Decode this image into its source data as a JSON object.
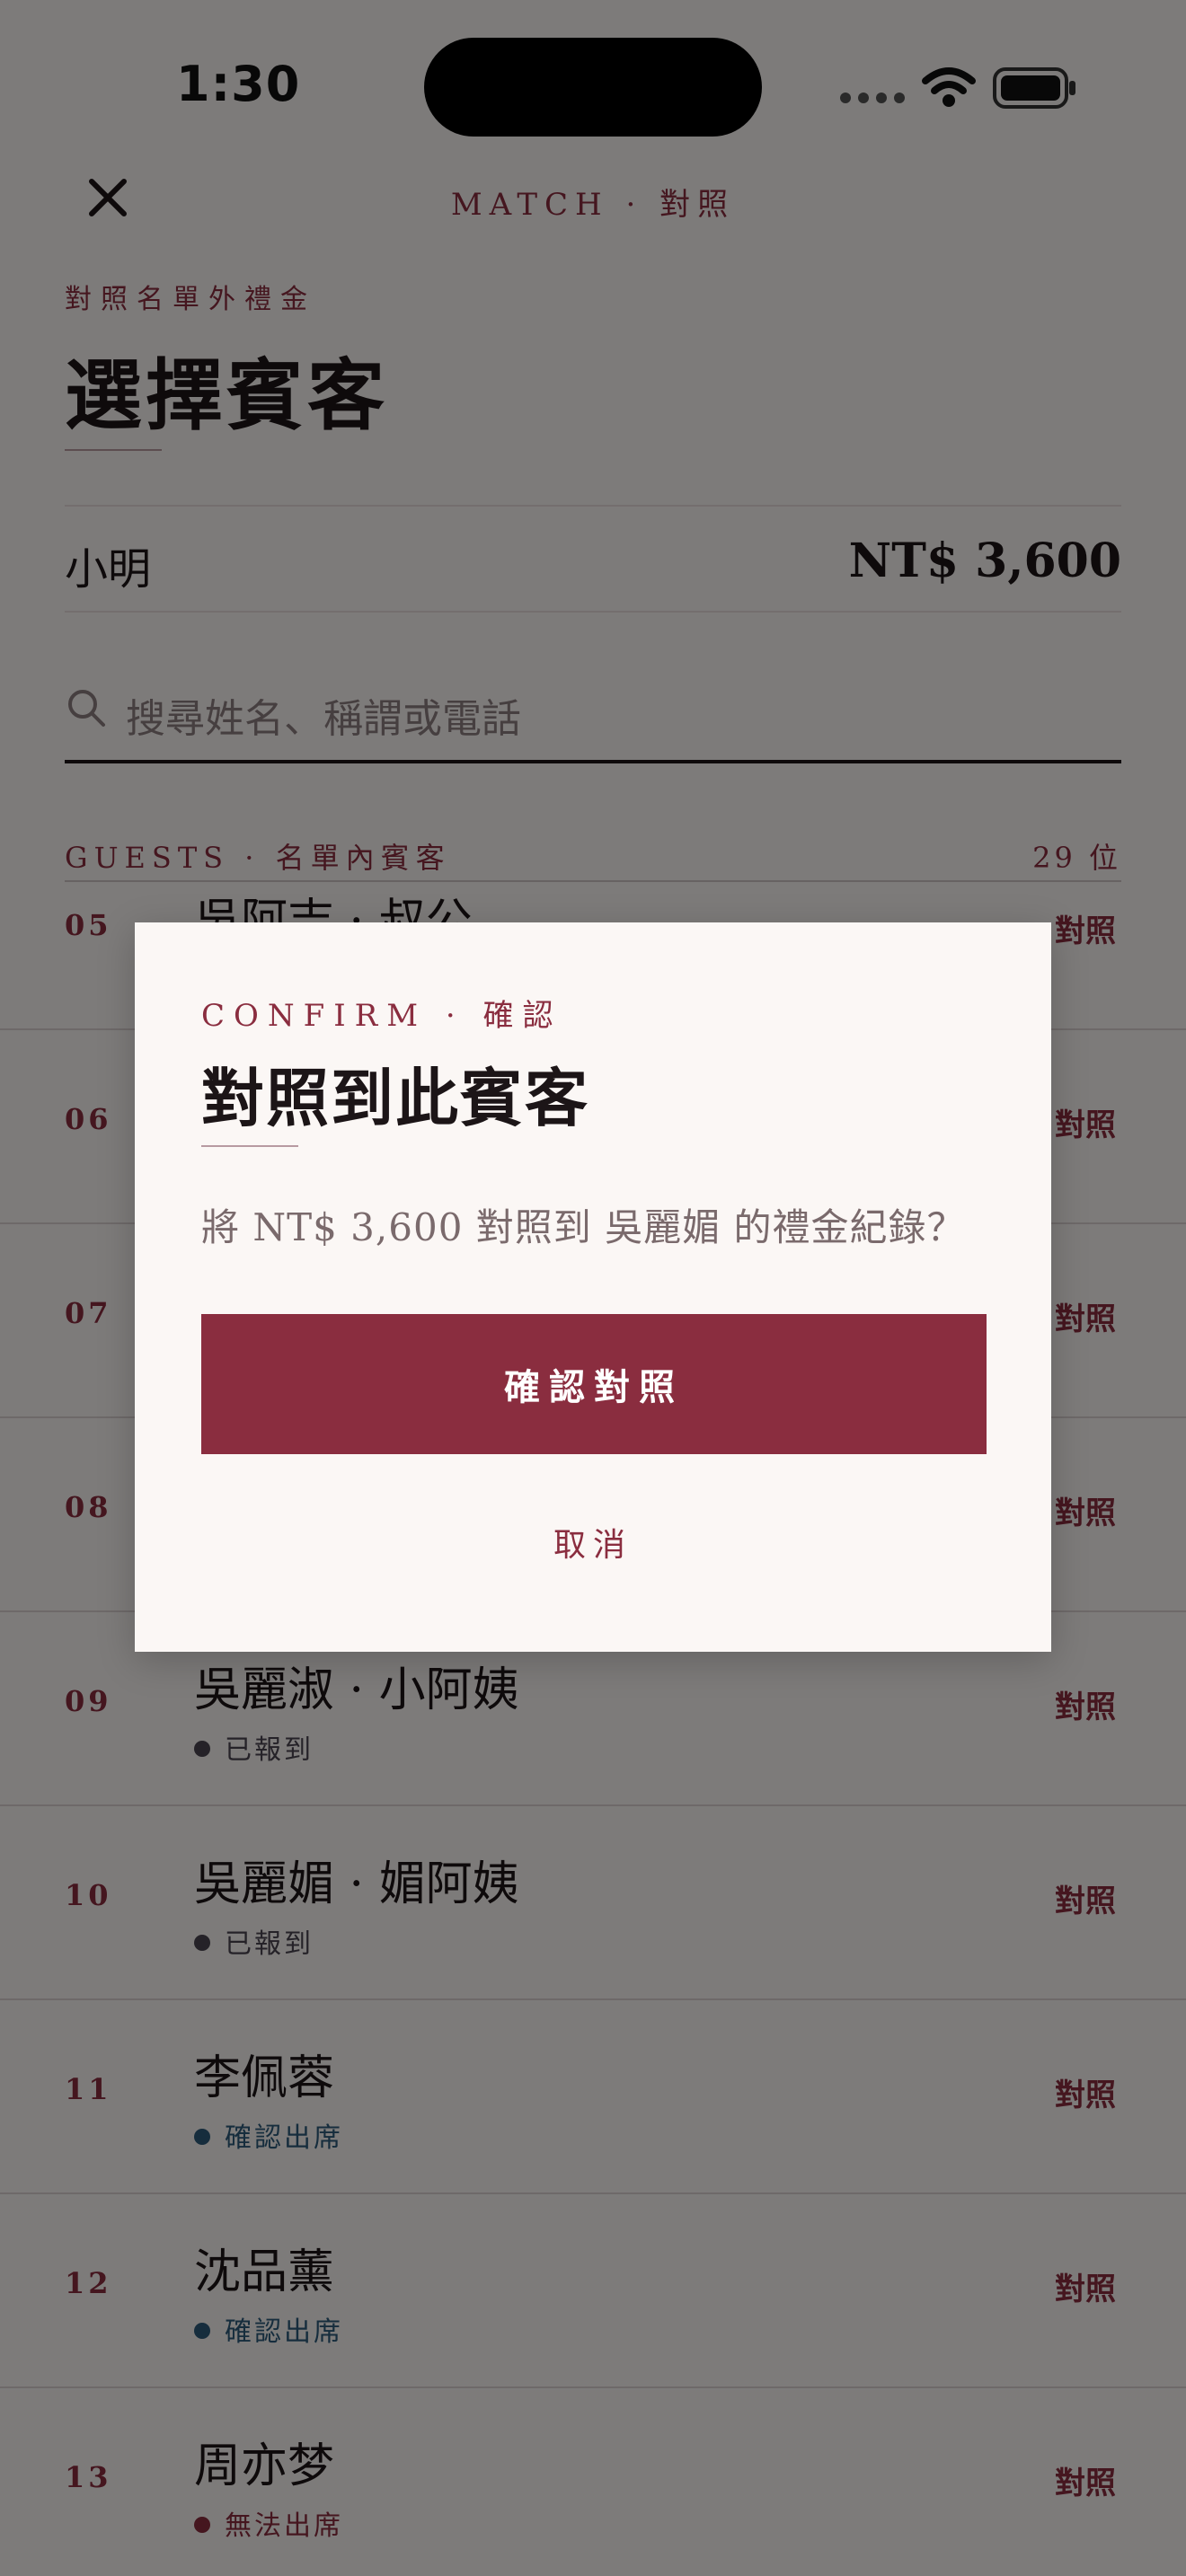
{
  "status_bar": {
    "time": "1:30"
  },
  "header": {
    "title": "MATCH · 對照",
    "close_icon": "close-icon"
  },
  "page": {
    "eyebrow": "對照名單外禮金",
    "title": "選擇賓客"
  },
  "summary": {
    "name": "小明",
    "amount": "NT$ 3,600"
  },
  "search": {
    "placeholder": "搜尋姓名、稱謂或電話",
    "icon": "search-icon"
  },
  "list": {
    "header_label": "GUESTS · 名單內賓客",
    "count": "29 位",
    "match_label": "對照",
    "rows": [
      {
        "num": "05",
        "name": "吳阿吉 · 叔公",
        "status": "",
        "status_color": ""
      },
      {
        "num": "06",
        "name": "",
        "status": "",
        "status_color": ""
      },
      {
        "num": "07",
        "name": "",
        "status": "",
        "status_color": ""
      },
      {
        "num": "08",
        "name": "",
        "status": "",
        "status_color": ""
      },
      {
        "num": "09",
        "name": "吳麗淑 · 小阿姨",
        "status": "已報到",
        "status_color": "#4a4550"
      },
      {
        "num": "10",
        "name": "吳麗媚 · 媚阿姨",
        "status": "已報到",
        "status_color": "#4a4550"
      },
      {
        "num": "11",
        "name": "李佩蓉",
        "status": "確認出席",
        "status_color": "#2c5a7a"
      },
      {
        "num": "12",
        "name": "沈品薰",
        "status": "確認出席",
        "status_color": "#2c5a7a"
      },
      {
        "num": "13",
        "name": "周亦梦",
        "status": "無法出席",
        "status_color": "#8a2d3f"
      }
    ]
  },
  "dialog": {
    "eyebrow": "CONFIRM · 確認",
    "title": "對照到此賓客",
    "message": "將 NT$ 3,600 對照到 吳麗媚 的禮金紀錄？",
    "confirm_label": "確認對照",
    "cancel_label": "取消"
  },
  "colors": {
    "accent": "#8a2d3f",
    "background": "#fbf7f5",
    "scrim": "rgba(0,0,0,0.5)"
  }
}
